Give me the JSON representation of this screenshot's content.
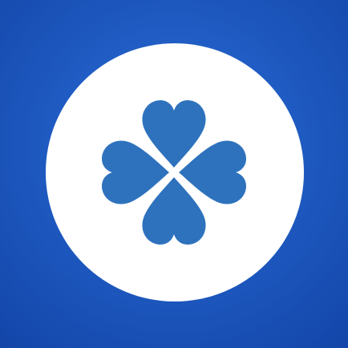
{
  "app_icon": {
    "icon": "clover-icon",
    "colors": {
      "background": "#1f5bc2",
      "background_edge": "#1345a8",
      "badge": "#ffffff",
      "clover": "#2e72bd"
    }
  }
}
